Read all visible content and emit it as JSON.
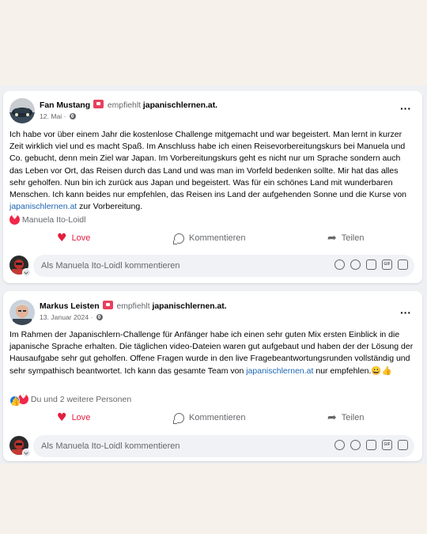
{
  "posts": [
    {
      "author": "Fan Mustang",
      "recommends_text": "empfiehlt",
      "page": "japanischlernen.at.",
      "date": "12. Mai ·",
      "body_before_link": "Ich habe vor über einem Jahr die kostenlose Challenge mitgemacht und war begeistert. Man lernt in kurzer Zeit wirklich viel und es macht Spaß. Im Anschluss habe ich einen Reisevorbereitungskurs bei Manuela und Co. gebucht, denn mein Ziel war Japan. Im Vorbereitungskurs geht es nicht nur um Sprache sondern auch das Leben vor Ort, das Reisen durch das Land und was man im Vorfeld bedenken sollte. Mir hat das alles sehr geholfen. Nun bin ich zurück aus Japan und begeistert. Was für ein schönes Land mit wunderbaren Menschen. Ich kann beides nur empfehlen, das Reisen ins Land der aufgehenden Sonne und die Kurse von ",
      "body_link": "japanischlernen.at",
      "body_after_link": " zur Vorbereitung.",
      "reactions_text": "Manuela Ito-Loidl",
      "actions": {
        "love": "Love",
        "comment": "Kommentieren",
        "share": "Teilen"
      },
      "comment_placeholder": "Als Manuela Ito-Loidl kommentieren"
    },
    {
      "author": "Markus Leisten",
      "recommends_text": "empfiehlt",
      "page": "japanischlernen.at.",
      "date": "13. Januar 2024 ·",
      "body_before_link": "Im Rahmen der Japanischlern-Challenge für Anfänger habe ich einen sehr guten Mix ersten Einblick in die japanische Sprache erhalten. Die täglichen video-Dateien waren  gut aufgebaut und haben der der Lösung der Hausaufgabe sehr gut geholfen. Offene Fragen wurde in den live Fragebeantwortungsrunden vollständig und sehr sympathisch beantwortet. Ich kann das gesamte Team von ",
      "body_link": "japanischlernen.at",
      "body_after_link": " nur empfehlen.😀👍",
      "reactions_text": "Du und 2 weitere Personen",
      "actions": {
        "love": "Love",
        "comment": "Kommentieren",
        "share": "Teilen"
      },
      "comment_placeholder": "Als Manuela Ito-Loidl kommentieren"
    }
  ],
  "icons": {
    "more": "more-options-icon",
    "privacy": "globe-icon",
    "recommend": "recommend-badge-icon",
    "reaction_love": "heart-reaction-icon",
    "reaction_like": "like-reaction-icon",
    "input": [
      "avatar-sticker-icon",
      "emoji-icon",
      "camera-icon",
      "gif-icon",
      "sticker-icon"
    ]
  },
  "colors": {
    "link": "#1d66b3",
    "love": "#e41e3f",
    "background": "#f6f1ea"
  }
}
